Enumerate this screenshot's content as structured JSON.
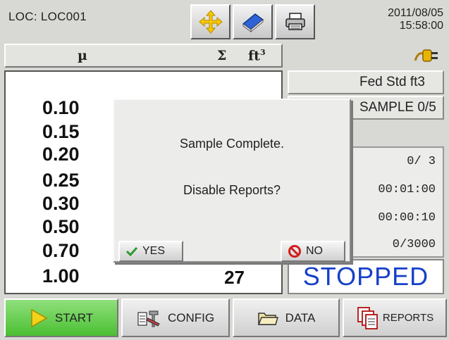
{
  "header": {
    "location": "LOC:  LOC001",
    "date": "2011/08/05",
    "time": "15:58:00"
  },
  "toolbar": {
    "buttons": [
      {
        "icon": "move-arrows-icon"
      },
      {
        "icon": "book-icon"
      },
      {
        "icon": "printer-icon"
      }
    ]
  },
  "table": {
    "col_size": "µ",
    "col_sum": "Σ",
    "col_unit": "ft",
    "col_unit_sup": "3",
    "sizes": [
      "0.10",
      "0.15",
      "0.20",
      "0.25",
      "0.30",
      "0.50",
      "0.70",
      "1.00"
    ],
    "last_count": "27"
  },
  "status": {
    "std_label": "Fed Std ft3",
    "sample_label": "SAMPLE 0/5",
    "values": [
      "0/  3",
      "00:01:00",
      "00:00:10",
      "0/3000"
    ],
    "state": "STOPPED"
  },
  "dialog": {
    "message": "Sample Complete.",
    "question": "Disable Reports?",
    "yes_label": "YES",
    "no_label": "NO"
  },
  "bottom_nav": {
    "start": "START",
    "config": "CONFIG",
    "data": "DATA",
    "reports": "REPORTS"
  },
  "colors": {
    "stopped": "#1540c8",
    "start_bg": "#4bbf33"
  }
}
